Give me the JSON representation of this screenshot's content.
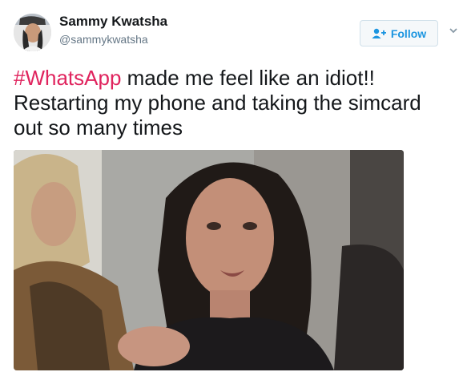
{
  "author": {
    "display_name": "Sammy Kwatsha",
    "handle": "@sammykwatsha",
    "avatar_icon": "user-avatar-photo"
  },
  "follow_button": {
    "label": "Follow",
    "icon": "add-user-icon",
    "color": "#1b95e0"
  },
  "menu_icon": "chevron-down-icon",
  "tweet": {
    "hashtag": "#WhatsApp",
    "text_line_1_rest": " made me feel like an idiot!!",
    "text_line_2": "Restarting my phone and taking the simcard",
    "text_line_3": "out so many times",
    "hashtag_color": "#e0245e"
  },
  "media": {
    "type": "photo",
    "description_icon": "meme-photo"
  }
}
